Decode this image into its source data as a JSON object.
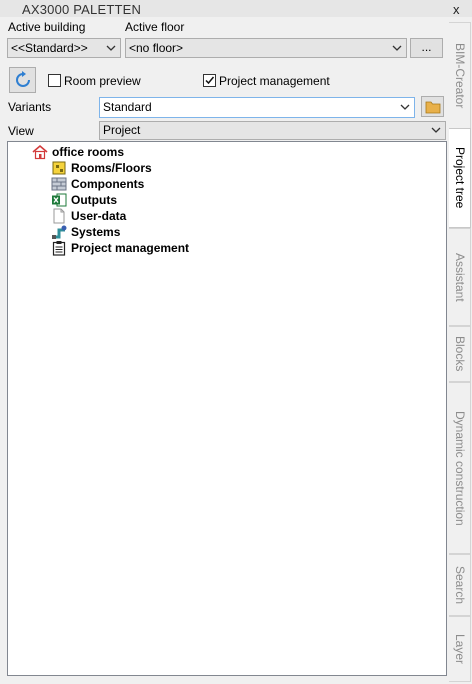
{
  "window": {
    "title": "AX3000 PALETTEN",
    "close_glyph": "x"
  },
  "building": {
    "label": "Active building",
    "value": "<<Standard>>"
  },
  "floor": {
    "label": "Active floor",
    "value": "<no floor>",
    "browse_label": "..."
  },
  "options": {
    "room_preview": {
      "label": "Room preview",
      "checked": false
    },
    "project_management": {
      "label": "Project management",
      "checked": true
    }
  },
  "variants": {
    "label": "Variants",
    "value": "Standard"
  },
  "view": {
    "label": "View",
    "value": "Project"
  },
  "tree": {
    "root": {
      "label": "office rooms",
      "icon": "house-icon"
    },
    "children": [
      {
        "label": "Rooms/Floors",
        "icon": "rooms-floors-icon"
      },
      {
        "label": "Components",
        "icon": "components-icon"
      },
      {
        "label": "Outputs",
        "icon": "excel-icon"
      },
      {
        "label": "User-data",
        "icon": "document-icon"
      },
      {
        "label": "Systems",
        "icon": "systems-icon"
      },
      {
        "label": "Project management",
        "icon": "clipboard-icon"
      }
    ]
  },
  "side_tabs": [
    {
      "label": "BIM-Creator",
      "active": false
    },
    {
      "label": "Project tree",
      "active": true
    },
    {
      "label": "Assistant",
      "active": false
    },
    {
      "label": "Blocks",
      "active": false
    },
    {
      "label": "Dynamic construction",
      "active": false
    },
    {
      "label": "Search",
      "active": false
    },
    {
      "label": "Layer",
      "active": false
    }
  ],
  "colors": {
    "accent_border": "#7eb4ea",
    "panel_bg": "#f0f0f0",
    "folder": "#e8b04a"
  }
}
